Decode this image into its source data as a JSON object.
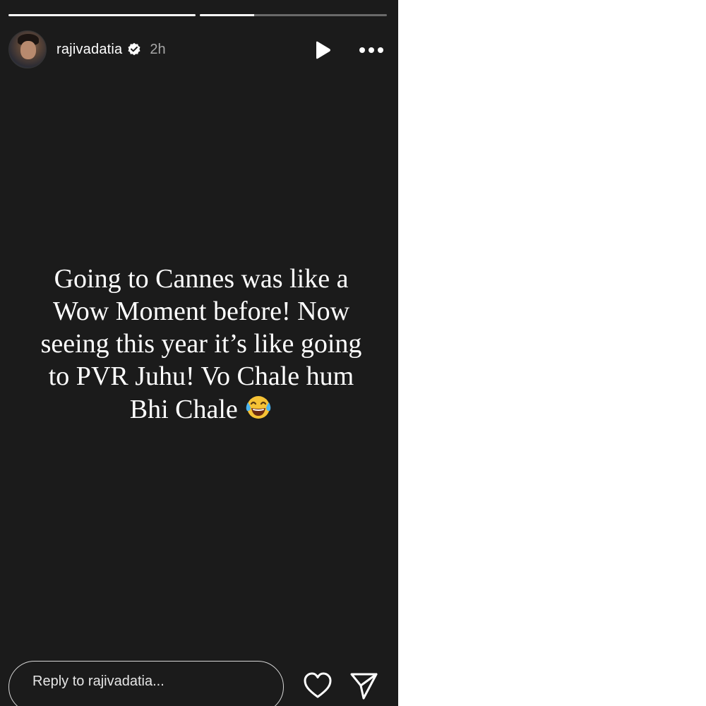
{
  "story": {
    "progress": [
      {
        "segment": 1,
        "fraction": 1.0
      },
      {
        "segment": 2,
        "fraction": 0.29
      }
    ],
    "header": {
      "username": "rajivadatia",
      "verified": true,
      "time_ago": "2h",
      "play_icon": "play-icon",
      "more_icon": "more-horizontal-icon"
    },
    "text_lines": "Going to Cannes was like a\nWow Moment before! Now\nseeing this year it’s like going\nto PVR Juhu! Vo Chale hum\nBhi Chale",
    "emoji": "face-with-tears-of-joy-icon",
    "footer": {
      "reply_placeholder": "Reply to rajivadatia...",
      "like_icon": "heart-icon",
      "share_icon": "send-icon"
    },
    "colors": {
      "background": "#1b1b1b",
      "text": "#ffffff",
      "muted": "#a8a8a8",
      "page": "#ffffff"
    }
  }
}
